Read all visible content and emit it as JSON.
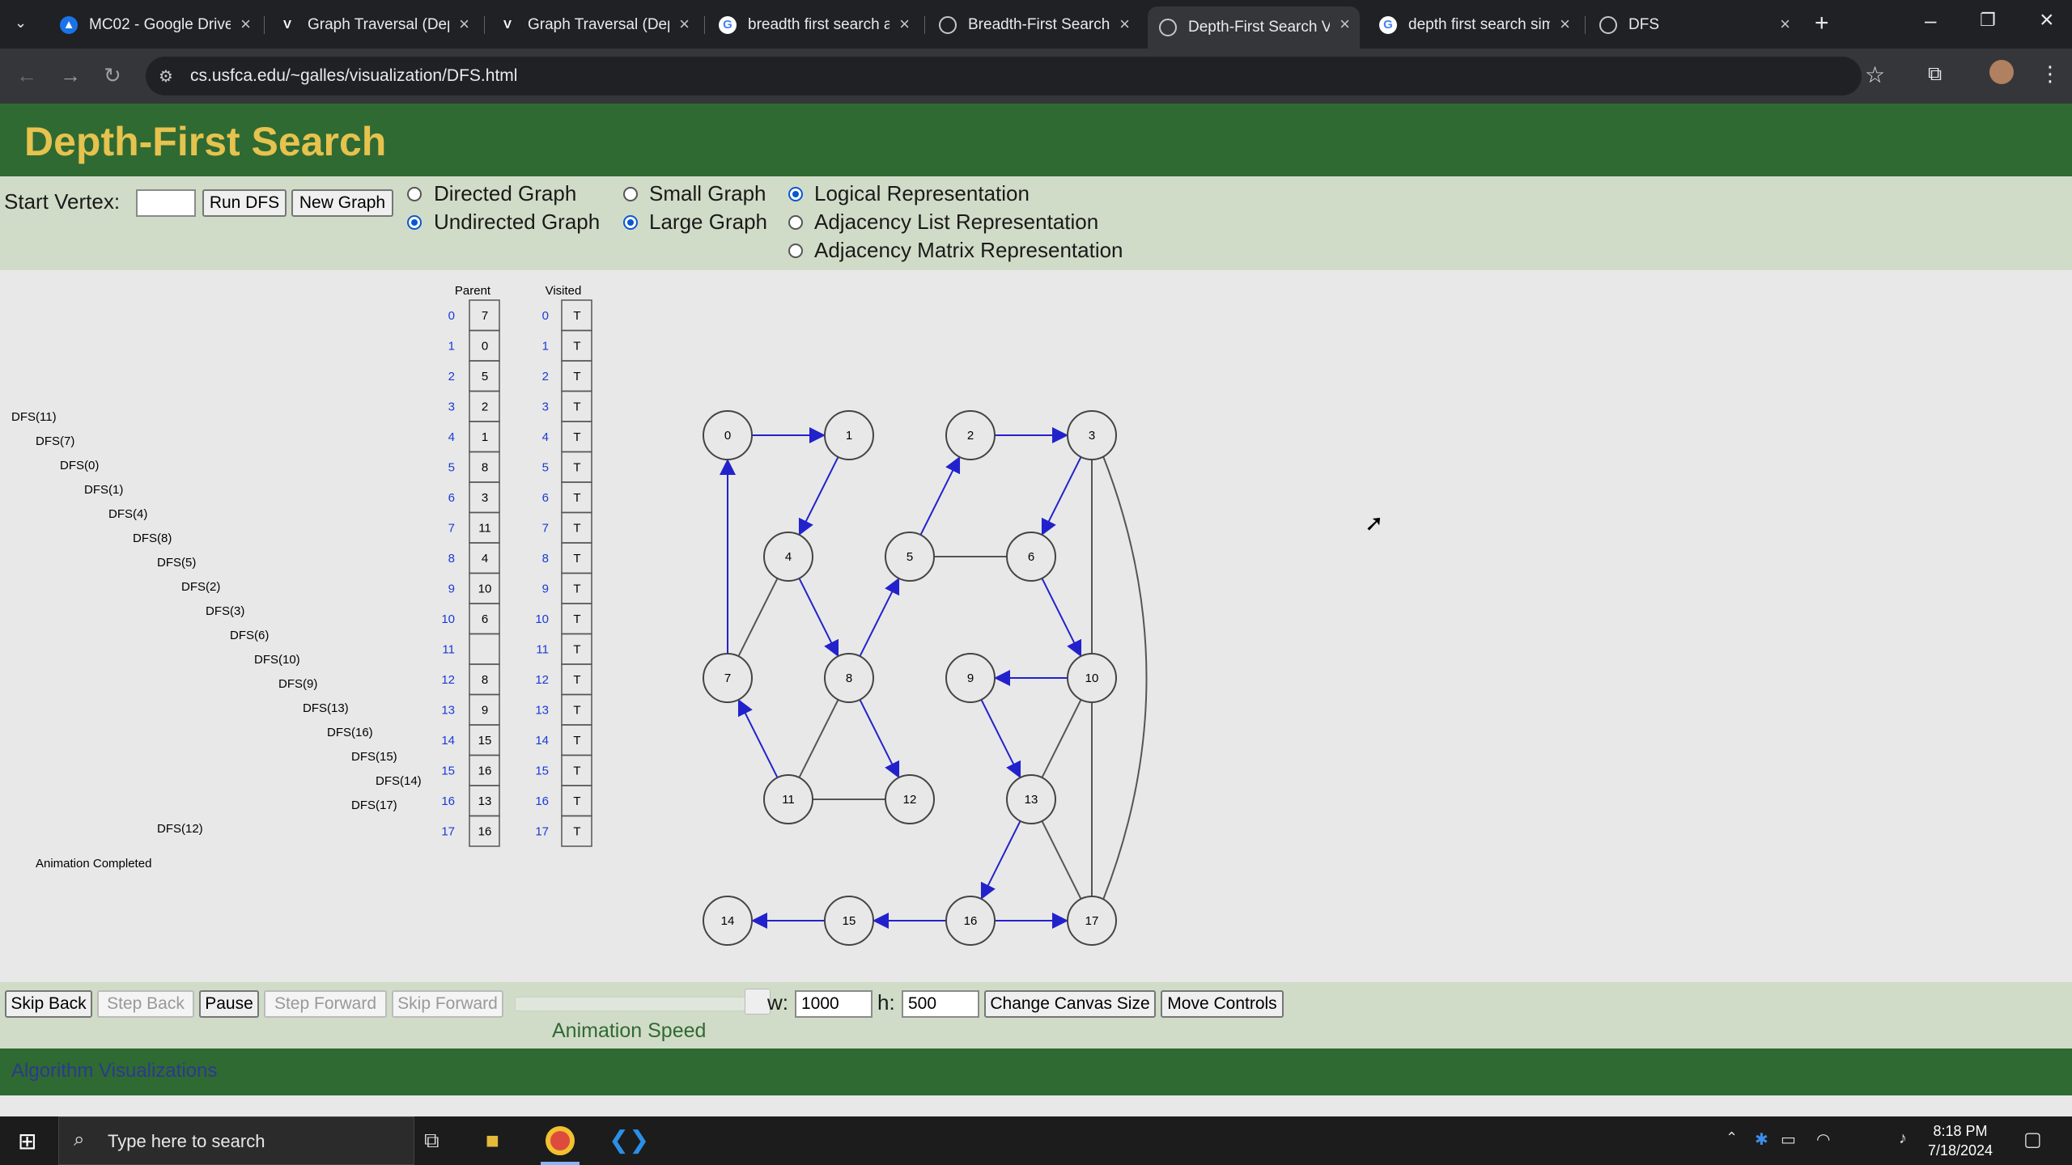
{
  "browser": {
    "tabs": [
      {
        "title": "MC02 - Google Drive",
        "icon": "google-drive-icon"
      },
      {
        "title": "Graph Traversal (Depth",
        "icon": "graph-site-icon"
      },
      {
        "title": "Graph Traversal (Depth",
        "icon": "graph-site-icon"
      },
      {
        "title": "breadth first search a",
        "icon": "google-icon"
      },
      {
        "title": "Breadth-First Search",
        "icon": "globe-icon"
      },
      {
        "title": "Depth-First Search V",
        "icon": "globe-icon"
      },
      {
        "title": "depth first search sim",
        "icon": "google-icon"
      },
      {
        "title": "DFS",
        "icon": "globe-icon"
      }
    ],
    "active_tab_index": 5,
    "url": "cs.usfca.edu/~galles/visualization/DFS.html"
  },
  "page": {
    "title": "Depth-First Search",
    "controls": {
      "start_vertex_label": "Start Vertex:",
      "start_vertex_value": "",
      "run_button": "Run DFS",
      "new_graph_button": "New Graph",
      "directed_label": "Directed Graph",
      "undirected_label": "Undirected Graph",
      "small_label": "Small Graph",
      "large_label": "Large Graph",
      "logical_label": "Logical Representation",
      "adj_list_label": "Adjacency List Representation",
      "adj_matrix_label": "Adjacency Matrix Representation",
      "graph_direction": "undirected",
      "graph_size": "large",
      "representation": "logical"
    },
    "call_stack": [
      "DFS(11)",
      "DFS(7)",
      "DFS(0)",
      "DFS(1)",
      "DFS(4)",
      "DFS(8)",
      "DFS(5)",
      "DFS(2)",
      "DFS(3)",
      "DFS(6)",
      "DFS(10)",
      "DFS(9)",
      "DFS(13)",
      "DFS(16)",
      "DFS(15)",
      "DFS(14)",
      "DFS(17)",
      "DFS(12)"
    ],
    "status": "Animation Completed",
    "parent_header": "Parent",
    "visited_header": "Visited",
    "parent_values": [
      "7",
      "0",
      "5",
      "2",
      "1",
      "8",
      "3",
      "11",
      "4",
      "10",
      "6",
      "",
      "8",
      "9",
      "15",
      "16",
      "13",
      "16"
    ],
    "visited_values": [
      "T",
      "T",
      "T",
      "T",
      "T",
      "T",
      "T",
      "T",
      "T",
      "T",
      "T",
      "T",
      "T",
      "T",
      "T",
      "T",
      "T",
      "T"
    ],
    "graph": {
      "nodes": [
        "0",
        "1",
        "2",
        "3",
        "4",
        "5",
        "6",
        "7",
        "8",
        "9",
        "10",
        "11",
        "12",
        "13",
        "14",
        "15",
        "16",
        "17"
      ],
      "tree_edge_color": "#2222cc",
      "plain_edge_color": "#555555"
    },
    "bottom": {
      "skip_back": "Skip Back",
      "step_back": "Step Back",
      "pause": "Pause",
      "step_forward": "Step Forward",
      "skip_forward": "Skip Forward",
      "animation_speed": "Animation Speed",
      "w_label": "w:",
      "w_value": "1000",
      "h_label": "h:",
      "h_value": "500",
      "change_canvas": "Change Canvas Size",
      "move_controls": "Move Controls"
    },
    "footer_link": "Algorithm Visualizations"
  },
  "taskbar": {
    "search_placeholder": "Type here to search",
    "time": "8:18 PM",
    "date": "7/18/2024"
  }
}
